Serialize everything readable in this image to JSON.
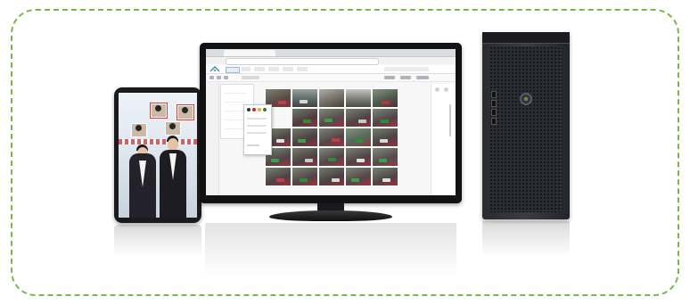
{
  "frame": {
    "border_color": "#7ab648"
  },
  "monitor_screen": {
    "tab_title": "",
    "url": "",
    "menu_items": [
      "",
      "",
      "",
      "",
      "",
      "",
      ""
    ],
    "panel_rows": [
      "",
      "",
      "",
      "",
      ""
    ]
  },
  "tower": {
    "brand": ""
  },
  "colors": {
    "monitor_bezel": "#111214",
    "tower_body": "#2a2b2f",
    "tablet_body": "#1b1b1d",
    "face_box": "#e53935"
  },
  "icons": [
    "monitor-icon",
    "tablet-icon",
    "server-tower-icon"
  ]
}
